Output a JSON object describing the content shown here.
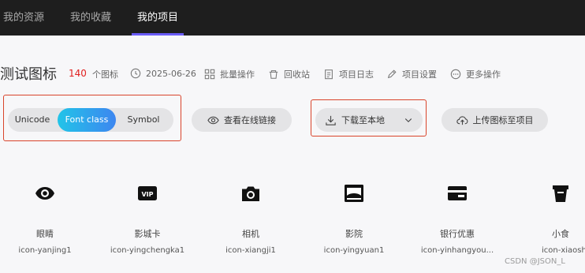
{
  "nav": {
    "tabs": [
      {
        "label": "我的资源"
      },
      {
        "label": "我的收藏"
      },
      {
        "label": "我的项目"
      }
    ]
  },
  "project": {
    "title": "测试图标",
    "icon_count": "140",
    "icon_count_label": "个图标",
    "date": "2025-06-26",
    "actions": [
      {
        "label": "批量操作",
        "icon": "batch-icon"
      },
      {
        "label": "回收站",
        "icon": "recycle-icon"
      },
      {
        "label": "项目日志",
        "icon": "log-icon"
      },
      {
        "label": "项目设置",
        "icon": "settings-icon"
      },
      {
        "label": "更多操作",
        "icon": "more-icon"
      }
    ]
  },
  "toolbar": {
    "formats": [
      "Unicode",
      "Font class",
      "Symbol"
    ],
    "active_format": "Font class",
    "view_online_link": "查看在线链接",
    "download_label": "下载至本地",
    "upload_label": "上传图标至项目"
  },
  "icons": [
    {
      "name": "眼睛",
      "class": "icon-yanjing1",
      "icon": "eye-icon"
    },
    {
      "name": "影城卡",
      "class": "icon-yingchengka1",
      "icon": "vip-card-icon"
    },
    {
      "name": "相机",
      "class": "icon-xiangji1",
      "icon": "camera-icon"
    },
    {
      "name": "影院",
      "class": "icon-yingyuan1",
      "icon": "cinema-icon"
    },
    {
      "name": "银行优惠",
      "class": "icon-yinhangyou...",
      "icon": "bank-card-icon"
    },
    {
      "name": "小食",
      "class": "icon-xiaosh",
      "icon": "snack-cup-icon"
    }
  ],
  "watermark": "CSDN @JSON_L",
  "colors": {
    "accent": "#6a5cf6",
    "active_gradient_start": "#22c4e8",
    "active_gradient_end": "#3d86f0",
    "highlight_border": "#d9442b",
    "count_red": "#e02020"
  }
}
